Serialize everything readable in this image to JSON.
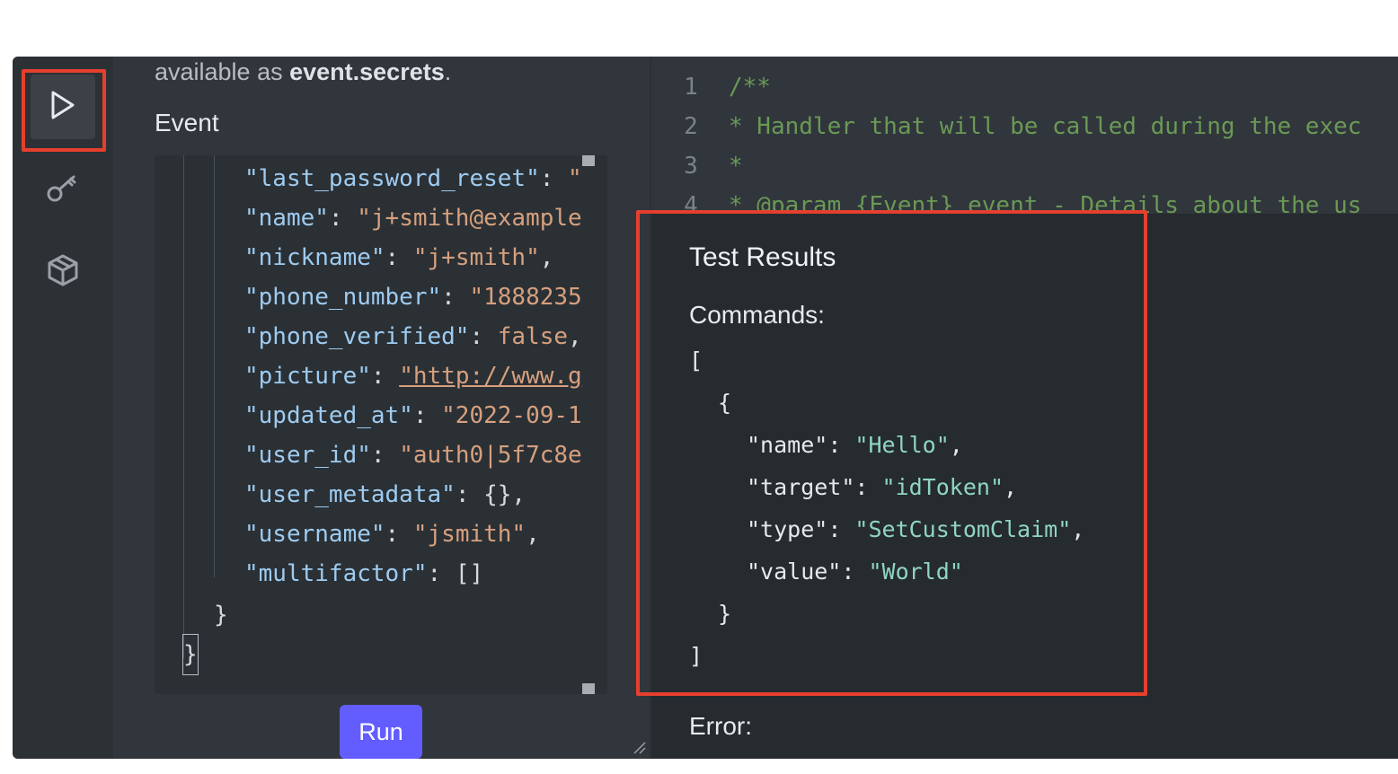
{
  "left_panel": {
    "secrets_note_prefix": "available as ",
    "secrets_note_bold": "event.secrets",
    "secrets_note_suffix": ".",
    "event_label": "Event",
    "event_lines": [
      {
        "key": "\"last_password_reset\"",
        "sep": ": ",
        "val": "\""
      },
      {
        "key": "\"name\"",
        "sep": ": ",
        "val": "\"j+smith@example"
      },
      {
        "key": "\"nickname\"",
        "sep": ": ",
        "val": "\"j+smith\"",
        "end": ","
      },
      {
        "key": "\"phone_number\"",
        "sep": ": ",
        "val": "\"1888235"
      },
      {
        "key": "\"phone_verified\"",
        "sep": ": ",
        "val": "false",
        "end": ","
      },
      {
        "key": "\"picture\"",
        "sep": ": ",
        "val": "\"http://www.g",
        "link": true
      },
      {
        "key": "\"updated_at\"",
        "sep": ": ",
        "val": "\"2022-09-1"
      },
      {
        "key": "\"user_id\"",
        "sep": ": ",
        "val": "\"auth0|5f7c8e"
      },
      {
        "key": "\"user_metadata\"",
        "sep": ": ",
        "val": "",
        "end": "{},"
      },
      {
        "key": "\"username\"",
        "sep": ": ",
        "val": "\"jsmith\"",
        "end": ","
      },
      {
        "key": "\"multifactor\"",
        "sep": ": ",
        "val": "",
        "end": "[]"
      }
    ],
    "inner_close": "}",
    "outer_close": "}",
    "run_label": "Run"
  },
  "code": {
    "line_numbers": [
      "1",
      "2",
      "3",
      "4"
    ],
    "lines": [
      "/**",
      "* Handler that will be called during the exec",
      "*",
      "* @param {Event} event - Details about the us"
    ]
  },
  "results": {
    "title": "Test Results",
    "commands_label": "Commands:",
    "open_bracket": "[",
    "open_brace": "{",
    "entries": [
      {
        "key": "\"name\"",
        "val": "\"Hello\"",
        "end": ","
      },
      {
        "key": "\"target\"",
        "val": "\"idToken\"",
        "end": ","
      },
      {
        "key": "\"type\"",
        "val": "\"SetCustomClaim\"",
        "end": ","
      },
      {
        "key": "\"value\"",
        "val": "\"World\"",
        "end": ""
      }
    ],
    "close_brace": "}",
    "close_bracket": "]",
    "error_label": "Error:"
  },
  "icons": {
    "activity": [
      "play-icon",
      "key-icon",
      "package-icon"
    ]
  },
  "colors": {
    "accent": "#635dff",
    "highlight": "#e53f2e",
    "json_key": "#9ecbf0",
    "json_string": "#d6a07e",
    "comment": "#6a9955"
  }
}
